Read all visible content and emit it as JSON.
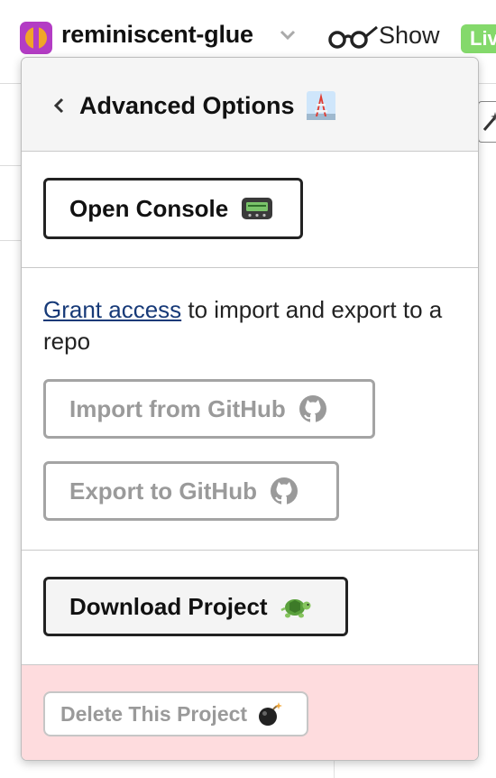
{
  "header": {
    "project_name": "reminiscent-glue",
    "show_label": "Show",
    "live_label": "Live"
  },
  "popover": {
    "title": "Advanced Options",
    "open_console_label": "Open Console",
    "grant_link_text": "Grant access",
    "grant_rest_text": " to import and export to a repo",
    "import_label": "Import from GitHub",
    "export_label": "Export to GitHub",
    "download_label": "Download Project",
    "delete_label": "Delete This Project"
  },
  "icons": {
    "title_emoji": "tokyo-tower-icon",
    "console_emoji": "pager-icon",
    "github": "github-icon",
    "download_emoji": "turtle-icon",
    "delete_emoji": "bomb-icon"
  },
  "colors": {
    "danger_bg": "#fedcde",
    "link": "#173a78",
    "live_badge": "#84d96b",
    "logo": "#b33cc4"
  }
}
